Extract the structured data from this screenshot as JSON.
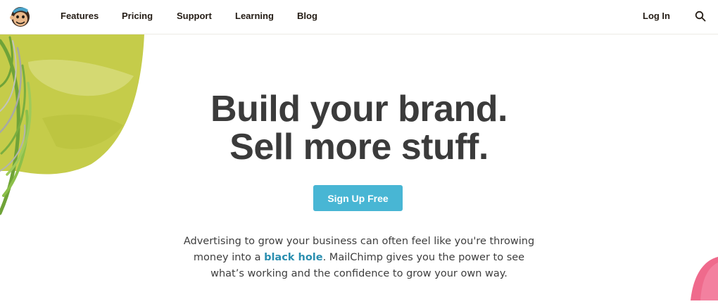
{
  "nav": {
    "logo_icon": "freddie-monkey-logo-icon",
    "items": [
      {
        "label": "Features"
      },
      {
        "label": "Pricing"
      },
      {
        "label": "Support"
      },
      {
        "label": "Learning"
      },
      {
        "label": "Blog"
      }
    ],
    "login_label": "Log In",
    "search_icon": "search-icon"
  },
  "hero": {
    "title_line1": "Build your brand.",
    "title_line2": "Sell more stuff.",
    "cta_label": "Sign Up Free",
    "body_part1": "Advertising to grow your business can often feel like you're throwing money into a ",
    "body_highlight": "black hole",
    "body_part2": ". MailChimp gives you the power to see what’s working and the confidence to grow your own way."
  },
  "colors": {
    "accent_button": "#48b6d4",
    "link_highlight": "#2b8fb0",
    "decor_green": "#c5cc4a",
    "decor_pink": "#ef6a8c"
  }
}
